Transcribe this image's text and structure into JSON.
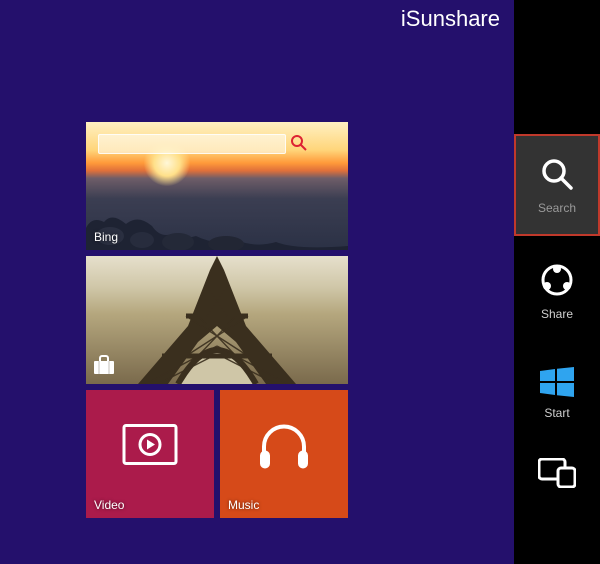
{
  "user": {
    "name": "iSunshare"
  },
  "tiles": {
    "bing": {
      "label": "Bing"
    },
    "travel": {
      "label": "Travel"
    },
    "video": {
      "label": "Video"
    },
    "music": {
      "label": "Music"
    }
  },
  "charms": {
    "search": {
      "label": "Search"
    },
    "share": {
      "label": "Share"
    },
    "start": {
      "label": "Start"
    },
    "devices": {
      "label": "Devices"
    }
  },
  "colors": {
    "start_bg": "#24106c",
    "charm_active_bg": "#333333",
    "charm_active_border": "#c0392b",
    "video_tile": "#ab1b4b",
    "music_tile": "#d64a19"
  }
}
